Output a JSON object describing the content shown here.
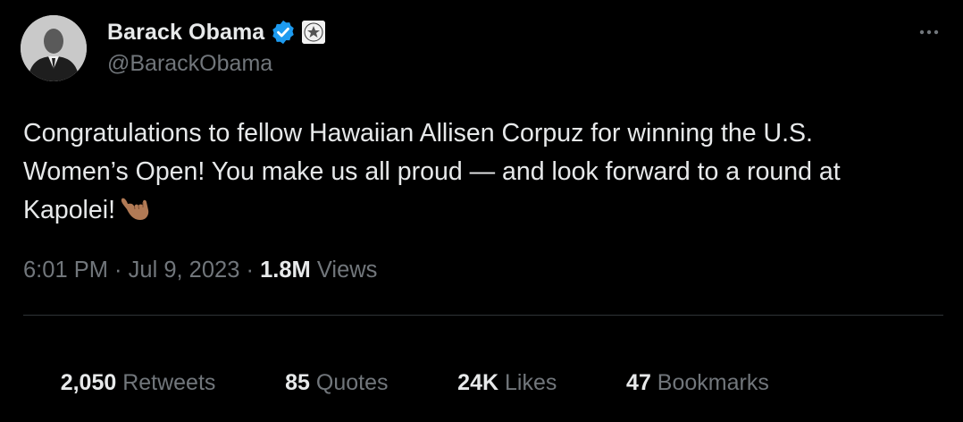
{
  "author": {
    "display_name": "Barack Obama",
    "handle": "@BarackObama",
    "verified": true,
    "affiliation_badge": "us-seal-icon"
  },
  "tweet": {
    "text_main": "Congratulations to fellow Hawaiian Allisen Corpuz for winning the U.S.\nWomen’s Open! You make us all proud — and look forward to a round at\nKapolei!",
    "emoji": "shaka-hand-icon"
  },
  "meta": {
    "time": "6:01 PM",
    "sep1": " · ",
    "date": "Jul 9, 2023",
    "sep2": " · ",
    "views_count": "1.8M",
    "views_label": " Views"
  },
  "stats": [
    {
      "count": "2,050",
      "label": " Retweets"
    },
    {
      "count": "85",
      "label": " Quotes"
    },
    {
      "count": "24K",
      "label": " Likes"
    },
    {
      "count": "47",
      "label": " Bookmarks"
    }
  ],
  "colors": {
    "background": "#000000",
    "text_primary": "#e7e9ea",
    "text_secondary": "#71767b",
    "verified_blue": "#1d9bf0",
    "divider": "#2f3336"
  }
}
